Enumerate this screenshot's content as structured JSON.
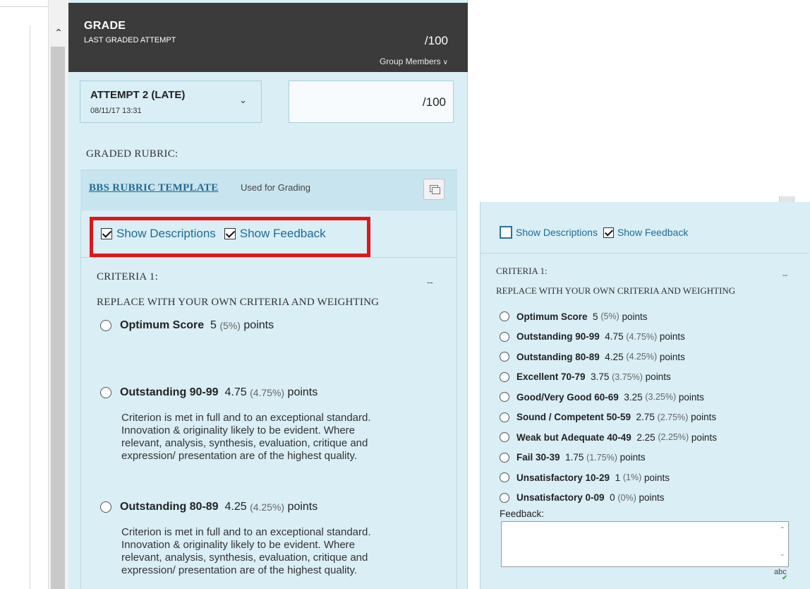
{
  "grade": {
    "title": "GRADE",
    "subtitle": "LAST GRADED ATTEMPT",
    "score": "/100",
    "group_members": "Group Members"
  },
  "attempt": {
    "label": "ATTEMPT 2 (LATE)",
    "date": "08/11/17 13:31"
  },
  "score_input": {
    "value": "/100"
  },
  "graded_rubric_label": "GRADED RUBRIC:",
  "rubric": {
    "name": "BBS RUBRIC TEMPLATE",
    "status": "Used for Grading"
  },
  "options": {
    "show_descriptions": "Show Descriptions",
    "show_feedback": "Show Feedback"
  },
  "criteria": {
    "title": "CRITERIA 1:",
    "score": "--",
    "description": "REPLACE WITH YOUR OWN CRITERIA AND WEIGHTING"
  },
  "levels": [
    {
      "name": "Optimum Score",
      "points": "5",
      "percent": "(5%)",
      "unit": "points",
      "description": []
    },
    {
      "name": "Outstanding 90-99",
      "points": "4.75",
      "percent": "(4.75%)",
      "unit": "points",
      "description": [
        "Criterion is met in full and to an exceptional standard.",
        "Innovation & originality likely to be evident. Where",
        "relevant, analysis, synthesis, evaluation, critique and",
        "expression/ presentation are of the highest quality."
      ]
    },
    {
      "name": "Outstanding 80-89",
      "points": "4.25",
      "percent": "(4.25%)",
      "unit": "points",
      "description": [
        "Criterion is met in full and to an exceptional standard.",
        "Innovation & originality likely to be evident. Where",
        "relevant, analysis, synthesis, evaluation, critique and",
        "expression/ presentation are of the highest quality."
      ]
    },
    {
      "name": "Excellent 70-79",
      "points": "3.75",
      "percent": "(3.75%)",
      "unit": "points"
    },
    {
      "name": "Good/Very Good 60-69",
      "points": "3.25",
      "percent": "(3.25%)",
      "unit": "points"
    },
    {
      "name": "Sound / Competent 50-59",
      "points": "2.75",
      "percent": "(2.75%)",
      "unit": "points"
    },
    {
      "name": "Weak but Adequate 40-49",
      "points": "2.25",
      "percent": "(2.25%)",
      "unit": "points"
    },
    {
      "name": "Fail 30-39",
      "points": "1.75",
      "percent": "(1.75%)",
      "unit": "points"
    },
    {
      "name": "Unsatisfactory 10-29",
      "points": "1",
      "percent": "(1%)",
      "unit": "points"
    },
    {
      "name": "Unsatisfactory 0-09",
      "points": "0",
      "percent": "(0%)",
      "unit": "points"
    }
  ],
  "feedback": {
    "label": "Feedback:",
    "spellcheck": "abc"
  },
  "icons": {
    "collapse": "chevron-up-icon",
    "dropdown": "chevron-down-icon",
    "popout": "popout-window-icon",
    "spellcheck": "spellcheck-icon"
  },
  "colors": {
    "header_bg": "#3b3b3b",
    "panel_bg": "#d9eef5",
    "link": "#1e6c96",
    "highlight": "#e0151b"
  }
}
